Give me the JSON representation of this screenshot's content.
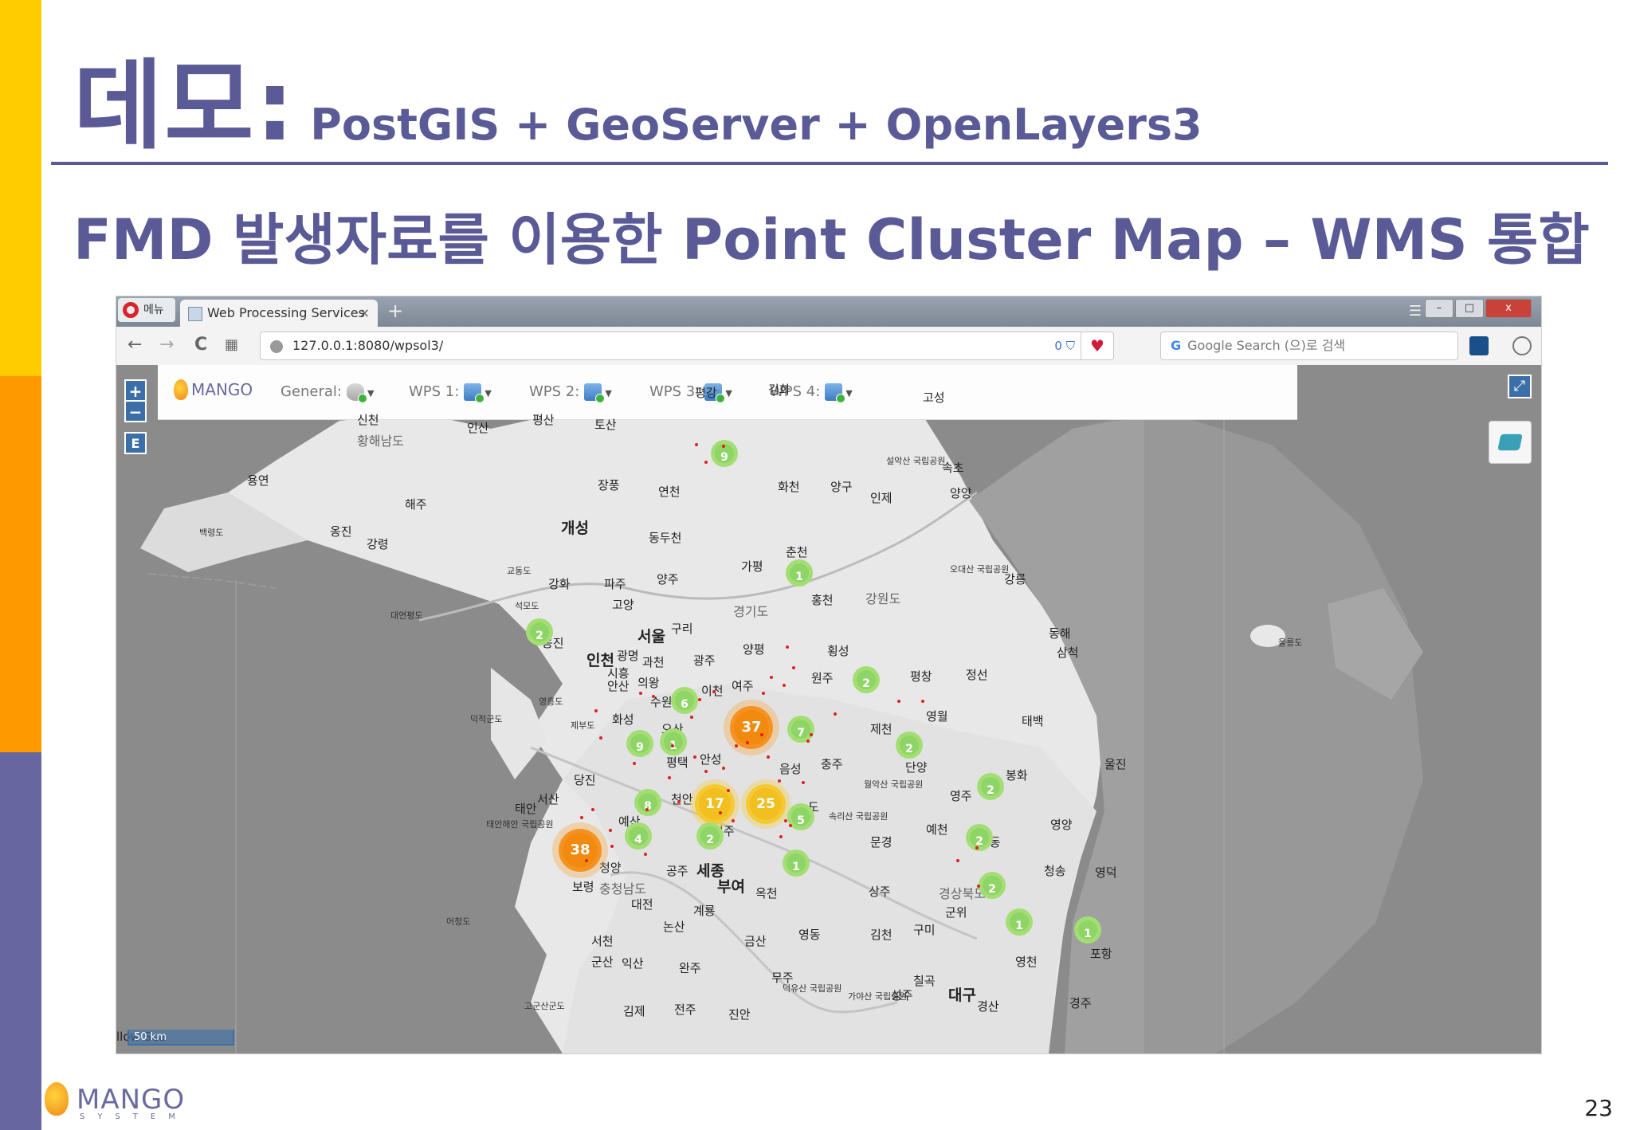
{
  "slide": {
    "title": "데모:",
    "title_sub": "PostGIS + GeoServer + OpenLayers3",
    "subtitle": "FMD 발생자료를 이용한 Point Cluster Map – WMS 통합",
    "page_number": "23",
    "footer_logo": "MANGO",
    "footer_logo_sub": "SYSTEM"
  },
  "browser": {
    "menu_label": "메뉴",
    "tab_title": "Web Processing Services",
    "tab_close": "×",
    "new_tab": "+",
    "url": "127.0.0.1:8080/wpsol3/",
    "shield_count": "0",
    "search_placeholder": "Google Search (으)로 검색",
    "back": "←",
    "forward": "→",
    "reload": "C",
    "speed_dial": "▦"
  },
  "app": {
    "logo": "MANGO",
    "tools": [
      {
        "label": "General:"
      },
      {
        "label": "WPS 1:"
      },
      {
        "label": "WPS 2:"
      },
      {
        "label": "WPS 3:"
      },
      {
        "label": "WPS 4:"
      }
    ],
    "zoom_in": "+",
    "zoom_out": "−",
    "edit": "E",
    "expand": "⤢",
    "scale_text": "50 km"
  },
  "map": {
    "labels": [
      {
        "t": "신천"
      },
      {
        "t": "황해남도"
      },
      {
        "t": "인산"
      },
      {
        "t": "평산"
      },
      {
        "t": "토산"
      },
      {
        "t": "연천"
      },
      {
        "t": "고성"
      },
      {
        "t": "설악산 국립공원"
      },
      {
        "t": "속초"
      },
      {
        "t": "양양"
      },
      {
        "t": "용연"
      },
      {
        "t": "해주"
      },
      {
        "t": "장풍"
      },
      {
        "t": "화천"
      },
      {
        "t": "양구"
      },
      {
        "t": "인제"
      },
      {
        "t": "백령도"
      },
      {
        "t": "옹진"
      },
      {
        "t": "강령"
      },
      {
        "t": "개성"
      },
      {
        "t": "동두천"
      },
      {
        "t": "춘천"
      },
      {
        "t": "교동도"
      },
      {
        "t": "강화"
      },
      {
        "t": "파주"
      },
      {
        "t": "양주"
      },
      {
        "t": "가평"
      },
      {
        "t": "홍천"
      },
      {
        "t": "강원도"
      },
      {
        "t": "오대산 국립공원"
      },
      {
        "t": "강릉"
      },
      {
        "t": "대연평도"
      },
      {
        "t": "석모도"
      },
      {
        "t": "고양"
      },
      {
        "t": "경기도"
      },
      {
        "t": "서울"
      },
      {
        "t": "구리"
      },
      {
        "t": "옹진"
      },
      {
        "t": "인천"
      },
      {
        "t": "광명"
      },
      {
        "t": "과천"
      },
      {
        "t": "광주"
      },
      {
        "t": "양평"
      },
      {
        "t": "횡성"
      },
      {
        "t": "시흥"
      },
      {
        "t": "안산"
      },
      {
        "t": "의왕"
      },
      {
        "t": "평창"
      },
      {
        "t": "정선"
      },
      {
        "t": "동해"
      },
      {
        "t": "삼척"
      },
      {
        "t": "울릉도"
      },
      {
        "t": "영흥도"
      },
      {
        "t": "수원"
      },
      {
        "t": "이천"
      },
      {
        "t": "여주"
      },
      {
        "t": "원주"
      },
      {
        "t": "덕적군도"
      },
      {
        "t": "제부도"
      },
      {
        "t": "화성"
      },
      {
        "t": "오산"
      },
      {
        "t": "영월"
      },
      {
        "t": "태백"
      },
      {
        "t": "제천"
      },
      {
        "t": "평택"
      },
      {
        "t": "안성"
      },
      {
        "t": "충주"
      },
      {
        "t": "단양"
      },
      {
        "t": "울진"
      },
      {
        "t": "음성"
      },
      {
        "t": "월악산 국립공원"
      },
      {
        "t": "영주"
      },
      {
        "t": "봉화"
      },
      {
        "t": "당진"
      },
      {
        "t": "서산"
      },
      {
        "t": "태안"
      },
      {
        "t": "천안"
      },
      {
        "t": "도"
      },
      {
        "t": "태안해안 국립공원"
      },
      {
        "t": "예산"
      },
      {
        "t": "속리산 국립공원"
      },
      {
        "t": "청주"
      },
      {
        "t": "예천"
      },
      {
        "t": "영양"
      },
      {
        "t": "문경"
      },
      {
        "t": "안동"
      },
      {
        "t": "청양"
      },
      {
        "t": "공주"
      },
      {
        "t": "세종"
      },
      {
        "t": "청송"
      },
      {
        "t": "영덕"
      },
      {
        "t": "상주"
      },
      {
        "t": "경상북도"
      },
      {
        "t": "보령"
      },
      {
        "t": "충청남도"
      },
      {
        "t": "대전"
      },
      {
        "t": "부여"
      },
      {
        "t": "옥천"
      },
      {
        "t": "계룡"
      },
      {
        "t": "군위"
      },
      {
        "t": "어청도"
      },
      {
        "t": "논산"
      },
      {
        "t": "금산"
      },
      {
        "t": "영동"
      },
      {
        "t": "김천"
      },
      {
        "t": "구미"
      },
      {
        "t": "서천"
      },
      {
        "t": "영천"
      },
      {
        "t": "포항"
      },
      {
        "t": "군산"
      },
      {
        "t": "익산"
      },
      {
        "t": "완주"
      },
      {
        "t": "무주"
      },
      {
        "t": "덕유산 국립공원"
      },
      {
        "t": "칠곡"
      },
      {
        "t": "성주"
      },
      {
        "t": "대구"
      },
      {
        "t": "경산"
      },
      {
        "t": "경주"
      },
      {
        "t": "가야산 국립공원"
      },
      {
        "t": "고군산군도"
      },
      {
        "t": "김제"
      },
      {
        "t": "전주"
      },
      {
        "t": "진안"
      },
      {
        "t": "평강"
      },
      {
        "t": "김화"
      },
      {
        "t": "llow Sea"
      }
    ],
    "clusters": [
      {
        "n": "9"
      },
      {
        "n": "1"
      },
      {
        "n": "2"
      },
      {
        "n": "2"
      },
      {
        "n": "6"
      },
      {
        "n": "37"
      },
      {
        "n": "7"
      },
      {
        "n": "9"
      },
      {
        "n": "1"
      },
      {
        "n": "2"
      },
      {
        "n": "2"
      },
      {
        "n": "8"
      },
      {
        "n": "17"
      },
      {
        "n": "25"
      },
      {
        "n": "5"
      },
      {
        "n": "38"
      },
      {
        "n": "4"
      },
      {
        "n": "2"
      },
      {
        "n": "1"
      },
      {
        "n": "2"
      },
      {
        "n": "2"
      },
      {
        "n": "1"
      },
      {
        "n": "1"
      }
    ]
  }
}
